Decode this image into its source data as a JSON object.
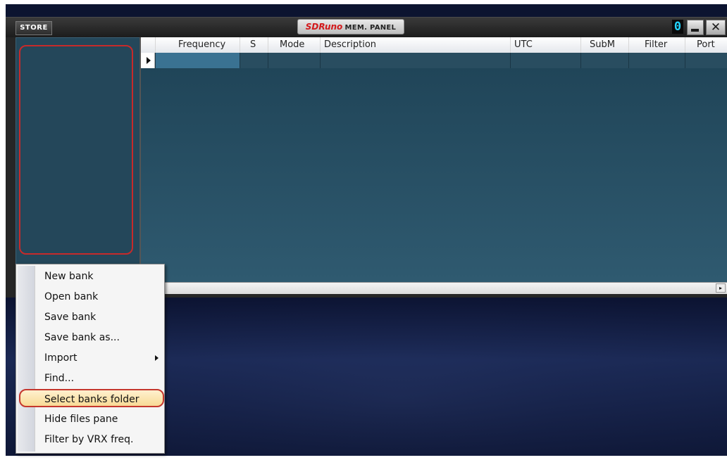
{
  "window": {
    "store_label": "STORE",
    "title_brand": "SDRuno",
    "title_text": "MEM. PANEL",
    "vrx_number": "0",
    "close_glyph": "✕"
  },
  "grid": {
    "columns": [
      "Frequency",
      "S",
      "Mode",
      "Description",
      "UTC",
      "SubM",
      "Filter",
      "Port"
    ],
    "rows": [
      [
        "",
        "",
        "",
        "",
        "",
        "",
        "",
        ""
      ]
    ],
    "scroll_right_glyph": "▸"
  },
  "context_menu": {
    "items": [
      {
        "label": "New bank",
        "has_submenu": false,
        "selected": false
      },
      {
        "label": "Open bank",
        "has_submenu": false,
        "selected": false
      },
      {
        "label": "Save bank",
        "has_submenu": false,
        "selected": false
      },
      {
        "label": "Save bank as...",
        "has_submenu": false,
        "selected": false
      },
      {
        "label": "Import",
        "has_submenu": true,
        "selected": false
      },
      {
        "label": "Find...",
        "has_submenu": false,
        "selected": false
      },
      {
        "label": "Select banks folder",
        "has_submenu": false,
        "selected": true
      },
      {
        "label": "Hide files pane",
        "has_submenu": false,
        "selected": false
      },
      {
        "label": "Filter by VRX freq.",
        "has_submenu": false,
        "selected": false
      }
    ]
  },
  "colors": {
    "files_pane": "#24475a",
    "highlight_border": "#c72a2a",
    "selected_cell": "#3a7292",
    "brand_red": "#d3191b",
    "vrx_cyan": "#23d4ff"
  },
  "icons": {
    "row_indicator": "triangle-right-icon",
    "minimize": "minimize-icon",
    "close": "close-icon",
    "submenu": "chevron-right-icon"
  }
}
